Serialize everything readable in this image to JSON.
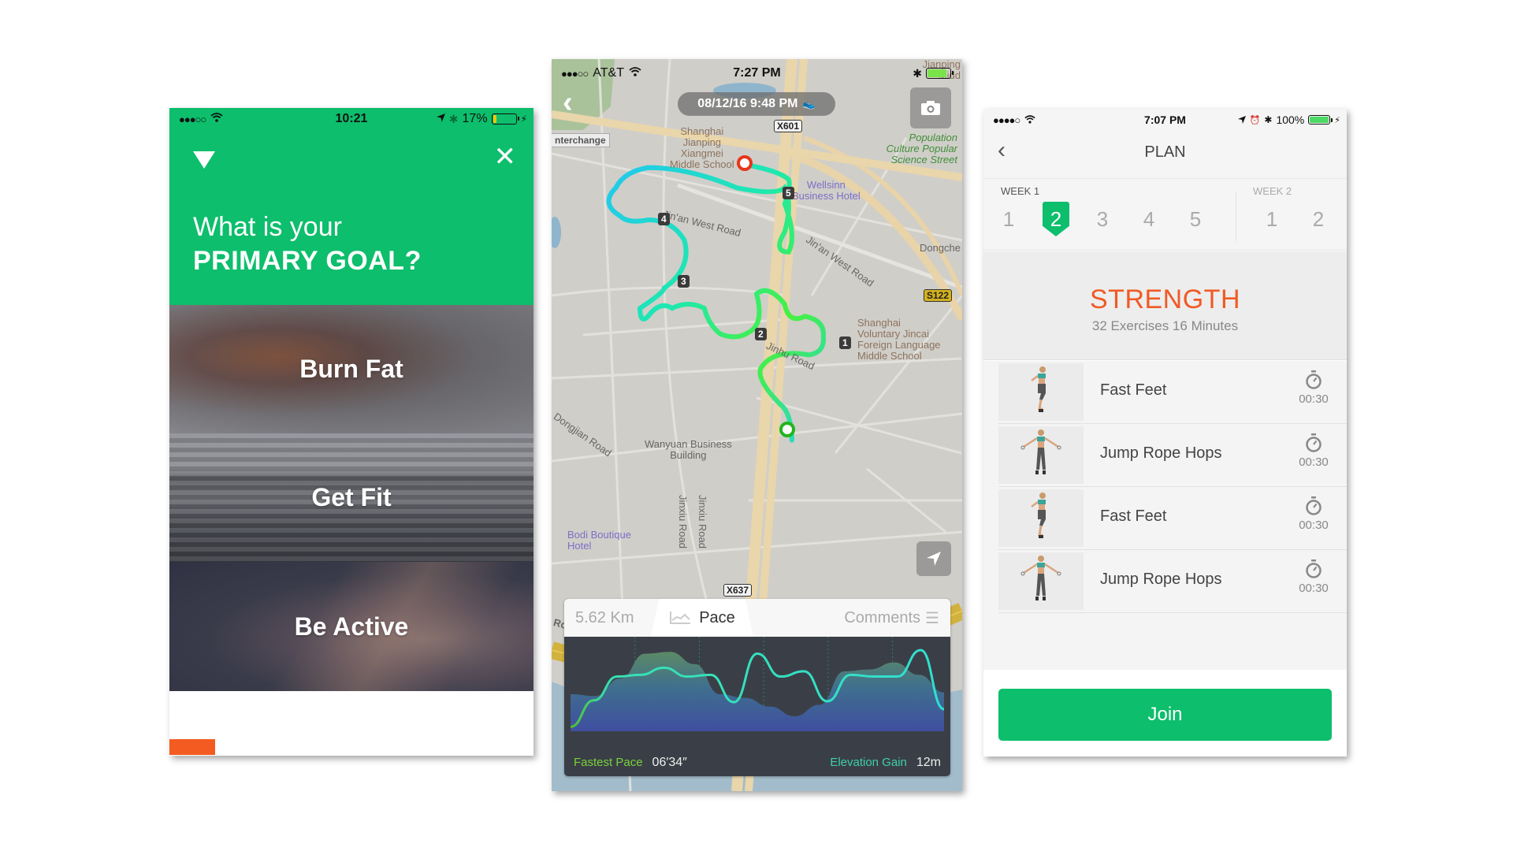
{
  "goal_screen": {
    "status": {
      "signal": "●●●○○",
      "time": "10:21",
      "battery": "17%",
      "battery_level": 0.17
    },
    "question_line1": "What is your",
    "question_line2": "PRIMARY GOAL?",
    "options": [
      {
        "label": "Burn Fat"
      },
      {
        "label": "Get Fit"
      },
      {
        "label": "Be Active"
      }
    ],
    "colors": {
      "header": "#0dbe6c",
      "accent": "#f45b21"
    }
  },
  "run_screen": {
    "status": {
      "signal": "●●●○○",
      "carrier": "AT&T",
      "time": "7:27 PM",
      "battery_level": 0.85
    },
    "datetime": "08/12/16 9:48 PM",
    "map_labels": {
      "interchange": "nterchange",
      "school1": "Shanghai\nJianping\nXiangmei\nMiddle School",
      "park": "Population\nCulture Popular\nScience Street",
      "hotel1": "Wellsinn\nBusiness Hotel",
      "dongche": "Dongche",
      "school2": "Shanghai\nVoluntary Jincai\nForeign Language\nMiddle School",
      "building": "Wanyuan Business\nBuilding",
      "hotel2": "Bodi Boutique\nHotel",
      "road_jinan": "Jin'an West Road",
      "road_jinan2": "Jin'an West Road",
      "road_jinhu": "Jinhu Road",
      "road_dongjian": "Dongjian Road",
      "road_jinxiu1": "Jinxiu Road",
      "road_jinxiu2": "Jinxiu Road",
      "road_bottom": "Road",
      "jianping_top": "Jianping\nMidd",
      "road_top": "Road"
    },
    "shields": {
      "x601": "X601",
      "s122": "S122",
      "x637": "X637"
    },
    "km_markers": [
      "1",
      "2",
      "3",
      "4",
      "5"
    ],
    "tabs": {
      "distance": "5.62 Km",
      "pace": "Pace",
      "comments": "Comments"
    },
    "stats": {
      "fastest_label": "Fastest Pace",
      "fastest_value": "06′34″",
      "elevation_label": "Elevation Gain",
      "elevation_value": "12m"
    },
    "pace_series": [
      0.05,
      0.35,
      0.62,
      0.64,
      0.72,
      0.62,
      0.64,
      0.33,
      0.88,
      0.62,
      0.68,
      0.34,
      0.64,
      0.62,
      0.62,
      0.92,
      0.25
    ],
    "elevation_series": [
      0.42,
      0.4,
      0.6,
      0.88,
      0.9,
      0.76,
      0.42,
      0.38,
      0.28,
      0.17,
      0.3,
      0.68,
      0.7,
      0.78,
      0.64,
      0.44
    ]
  },
  "plan_screen": {
    "status": {
      "signal": "●●●●○",
      "time": "7:07 PM",
      "battery": "100%",
      "battery_level": 1.0
    },
    "title": "PLAN",
    "weeks": [
      {
        "label": "WEEK 1",
        "days": [
          "1",
          "2",
          "3",
          "4",
          "5"
        ],
        "active": 1
      },
      {
        "label": "WEEK 2",
        "days": [
          "1",
          "2"
        ]
      }
    ],
    "workout": {
      "name": "STRENGTH",
      "meta": "32 Exercises  16 Minutes"
    },
    "exercises": [
      {
        "name": "Fast Feet",
        "duration": "00:30",
        "pose": "run"
      },
      {
        "name": "Jump Rope Hops",
        "duration": "00:30",
        "pose": "rope"
      },
      {
        "name": "Fast Feet",
        "duration": "00:30",
        "pose": "run"
      },
      {
        "name": "Jump Rope Hops",
        "duration": "00:30",
        "pose": "rope"
      }
    ],
    "join_label": "Join",
    "colors": {
      "accent": "#0dbe6c",
      "workout": "#f05a24"
    }
  }
}
